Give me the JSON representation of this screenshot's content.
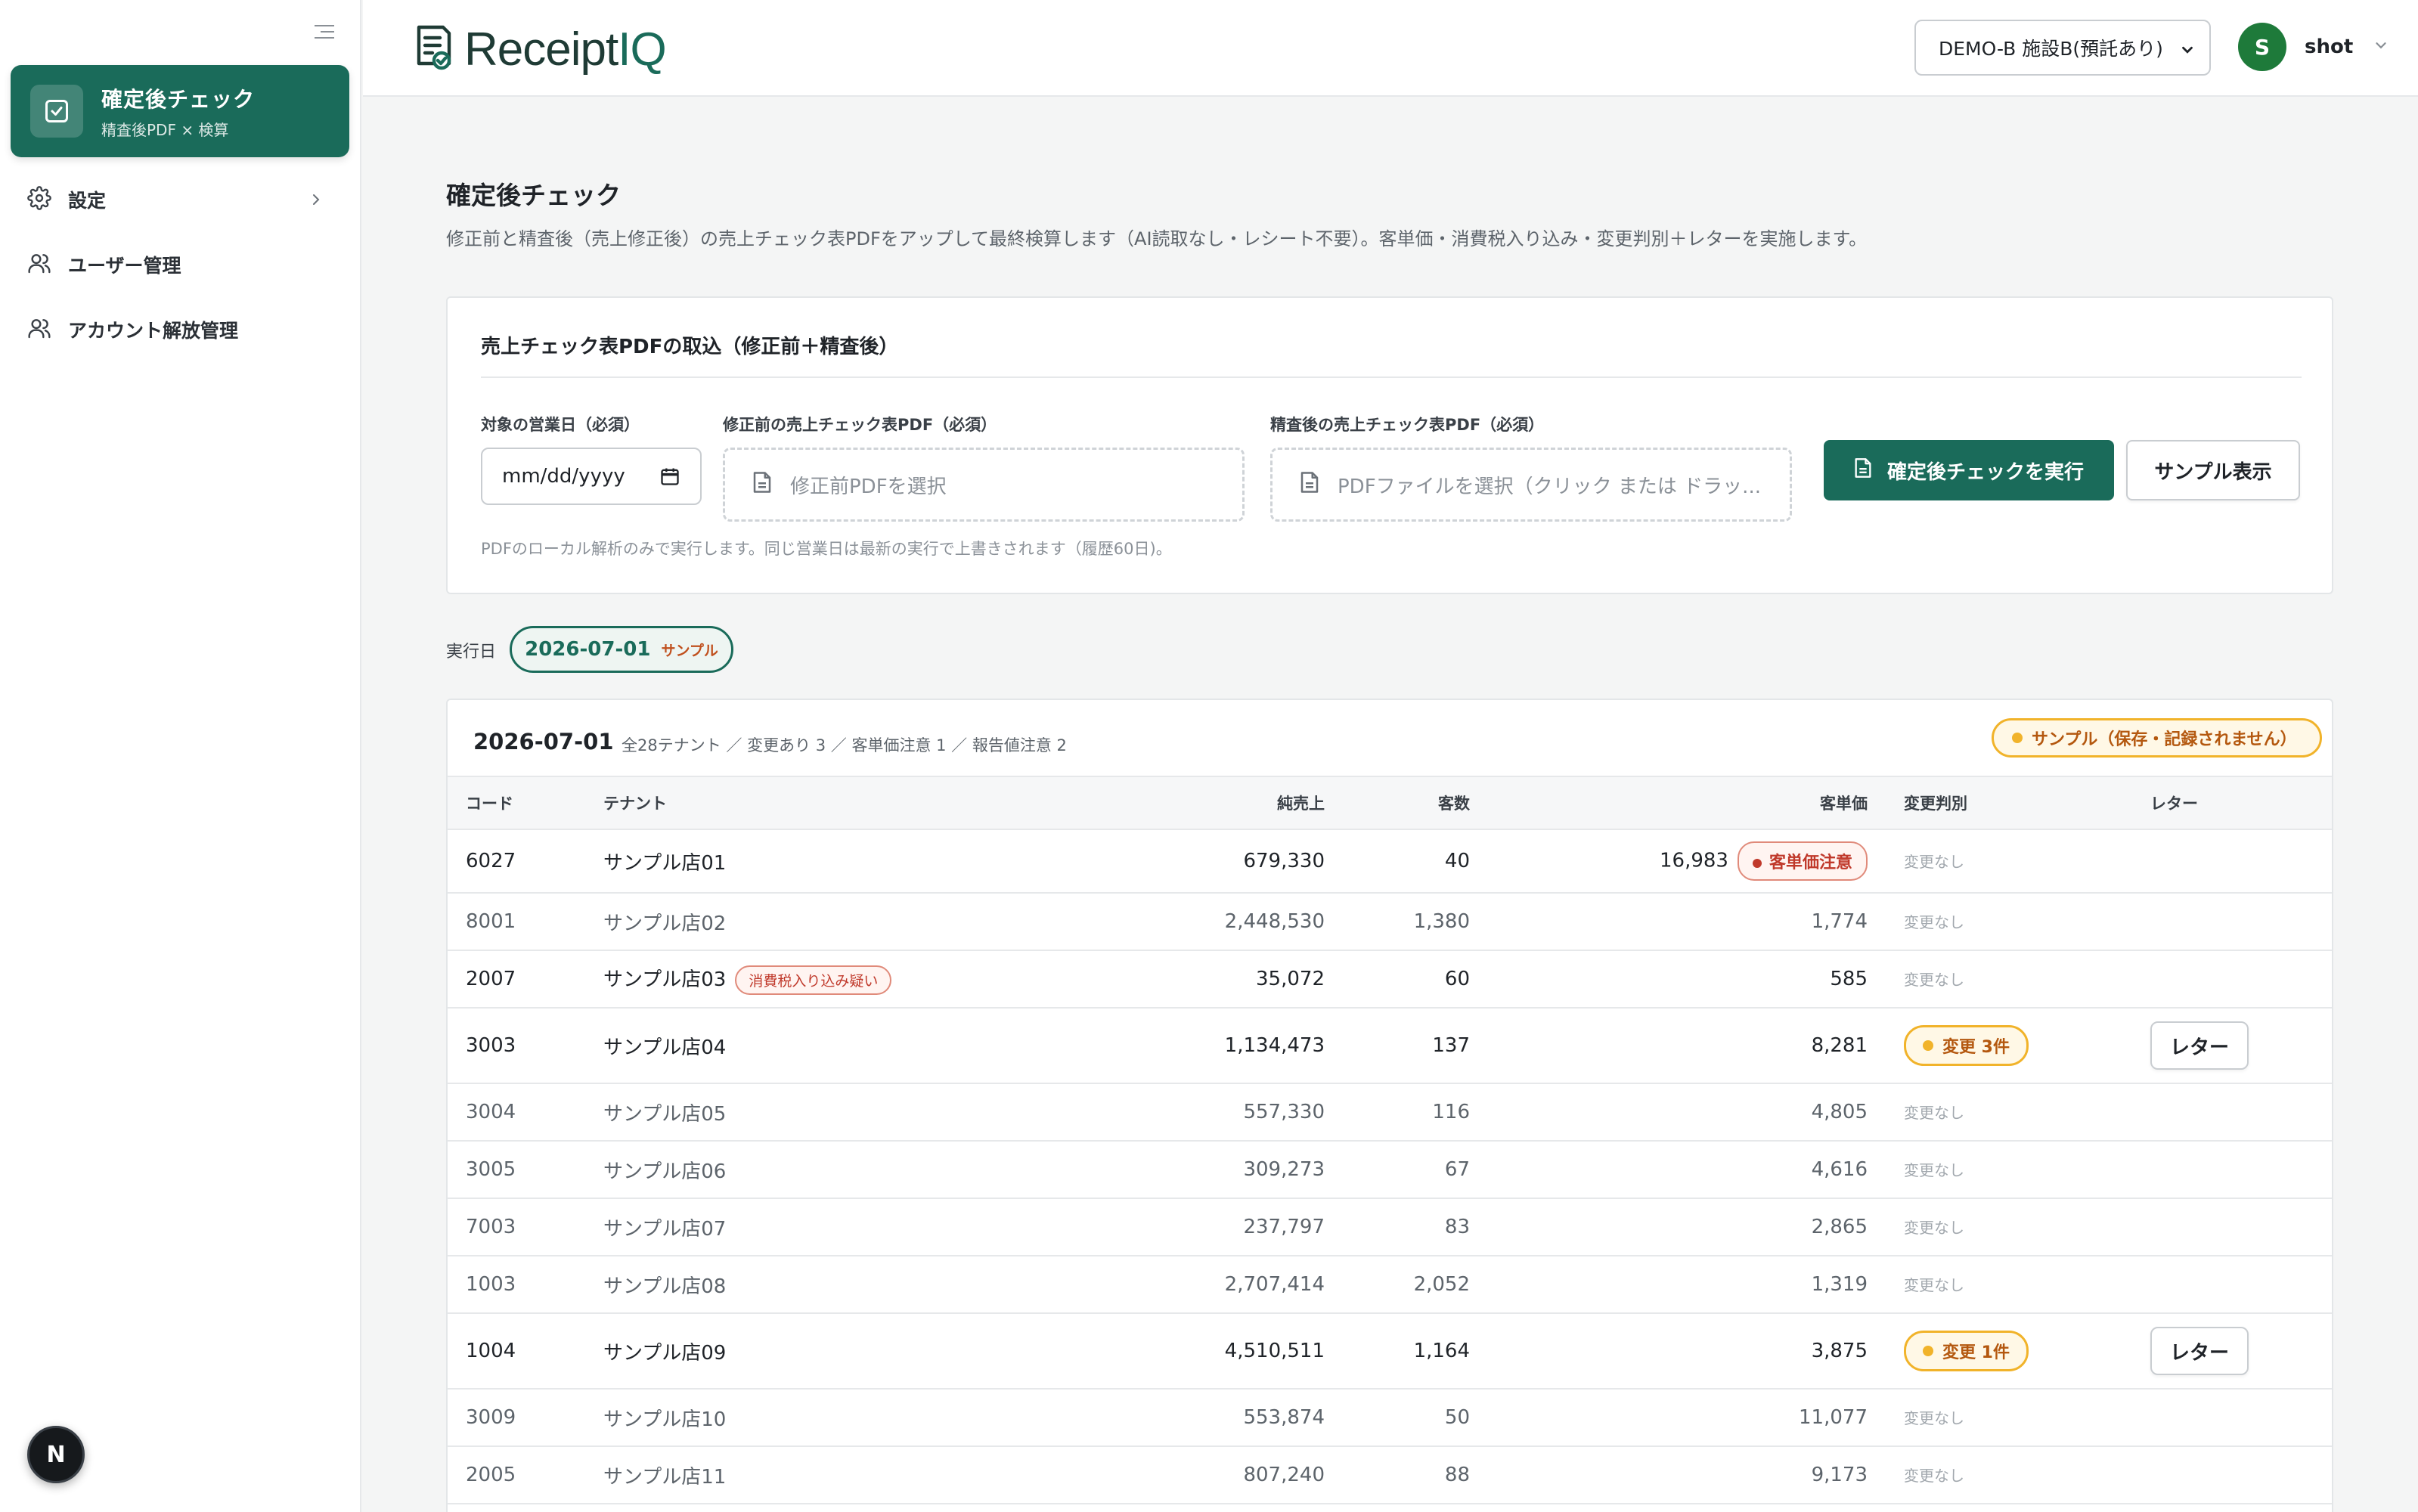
{
  "nav": {
    "active": {
      "title": "確定後チェック",
      "subtitle": "精査後PDF × 検算"
    },
    "items": [
      {
        "label": "設定"
      },
      {
        "label": "ユーザー管理"
      },
      {
        "label": "アカウント解放管理"
      }
    ],
    "badge": "N"
  },
  "header": {
    "logo_main": "Receipt",
    "logo_accent": "IQ",
    "facility": "DEMO-B 施設B(預託あり)",
    "user_initial": "S",
    "user_name": "shot"
  },
  "page": {
    "title": "確定後チェック",
    "description": "修正前と精査後（売上修正後）の売上チェック表PDFをアップして最終検算します（AI読取なし・レシート不要）。客単価・消費税入り込み・変更判別＋レターを実施します。"
  },
  "upload": {
    "title": "売上チェック表PDFの取込（修正前＋精査後）",
    "date_label": "対象の営業日（必須）",
    "date_placeholder": "mm/dd/yyyy",
    "before_label": "修正前の売上チェック表PDF（必須）",
    "before_placeholder": "修正前PDFを選択",
    "after_label": "精査後の売上チェック表PDF（必須）",
    "after_placeholder": "PDFファイルを選択（クリック または ドラッ...",
    "run_button": "確定後チェックを実行",
    "sample_button": "サンプル表示",
    "note": "PDFのローカル解析のみで実行します。同じ営業日は最新の実行で上書きされます（履歴60日)。"
  },
  "run": {
    "label": "実行日",
    "date": "2026-07-01",
    "sample_tag": "サンプル"
  },
  "result": {
    "date": "2026-07-01",
    "summary": "全28テナント ／ 変更あり 3 ／ 客単価注意 1 ／ 報告値注意 2",
    "warning": "サンプル（保存・記録されません）",
    "columns": [
      "コード",
      "テナント",
      "純売上",
      "客数",
      "客単価",
      "変更判別",
      "レター"
    ],
    "rows": [
      {
        "code": "6027",
        "tenant": "サンプル店01",
        "tenant_tag": "",
        "sales": "679,330",
        "customers": "40",
        "unit": "16,983",
        "unit_tag": "客単価注意",
        "change": "変更なし",
        "change_flag": false,
        "letter": ""
      },
      {
        "code": "8001",
        "tenant": "サンプル店02",
        "tenant_tag": "",
        "sales": "2,448,530",
        "customers": "1,380",
        "unit": "1,774",
        "unit_tag": "",
        "change": "変更なし",
        "change_flag": false,
        "letter": ""
      },
      {
        "code": "2007",
        "tenant": "サンプル店03",
        "tenant_tag": "消費税入り込み疑い",
        "sales": "35,072",
        "customers": "60",
        "unit": "585",
        "unit_tag": "",
        "change": "変更なし",
        "change_flag": false,
        "letter": ""
      },
      {
        "code": "3003",
        "tenant": "サンプル店04",
        "tenant_tag": "",
        "sales": "1,134,473",
        "customers": "137",
        "unit": "8,281",
        "unit_tag": "",
        "change": "変更 3件",
        "change_flag": true,
        "letter": "レター"
      },
      {
        "code": "3004",
        "tenant": "サンプル店05",
        "tenant_tag": "",
        "sales": "557,330",
        "customers": "116",
        "unit": "4,805",
        "unit_tag": "",
        "change": "変更なし",
        "change_flag": false,
        "letter": ""
      },
      {
        "code": "3005",
        "tenant": "サンプル店06",
        "tenant_tag": "",
        "sales": "309,273",
        "customers": "67",
        "unit": "4,616",
        "unit_tag": "",
        "change": "変更なし",
        "change_flag": false,
        "letter": ""
      },
      {
        "code": "7003",
        "tenant": "サンプル店07",
        "tenant_tag": "",
        "sales": "237,797",
        "customers": "83",
        "unit": "2,865",
        "unit_tag": "",
        "change": "変更なし",
        "change_flag": false,
        "letter": ""
      },
      {
        "code": "1003",
        "tenant": "サンプル店08",
        "tenant_tag": "",
        "sales": "2,707,414",
        "customers": "2,052",
        "unit": "1,319",
        "unit_tag": "",
        "change": "変更なし",
        "change_flag": false,
        "letter": ""
      },
      {
        "code": "1004",
        "tenant": "サンプル店09",
        "tenant_tag": "",
        "sales": "4,510,511",
        "customers": "1,164",
        "unit": "3,875",
        "unit_tag": "",
        "change": "変更 1件",
        "change_flag": true,
        "letter": "レター"
      },
      {
        "code": "3009",
        "tenant": "サンプル店10",
        "tenant_tag": "",
        "sales": "553,874",
        "customers": "50",
        "unit": "11,077",
        "unit_tag": "",
        "change": "変更なし",
        "change_flag": false,
        "letter": ""
      },
      {
        "code": "2005",
        "tenant": "サンプル店11",
        "tenant_tag": "",
        "sales": "807,240",
        "customers": "88",
        "unit": "9,173",
        "unit_tag": "",
        "change": "変更なし",
        "change_flag": false,
        "letter": ""
      }
    ]
  },
  "colors": {
    "primary": "#1a6b5a",
    "warning": "#f1b32a",
    "danger": "#c0392b",
    "avatar": "#1e7a3a"
  },
  "icons": [
    "sidebar-collapse-icon",
    "checklist-icon",
    "gear-icon",
    "users-icon",
    "receipt-logo-icon",
    "calendar-icon",
    "document-icon",
    "chevron-down-icon",
    "chevron-right-icon"
  ]
}
